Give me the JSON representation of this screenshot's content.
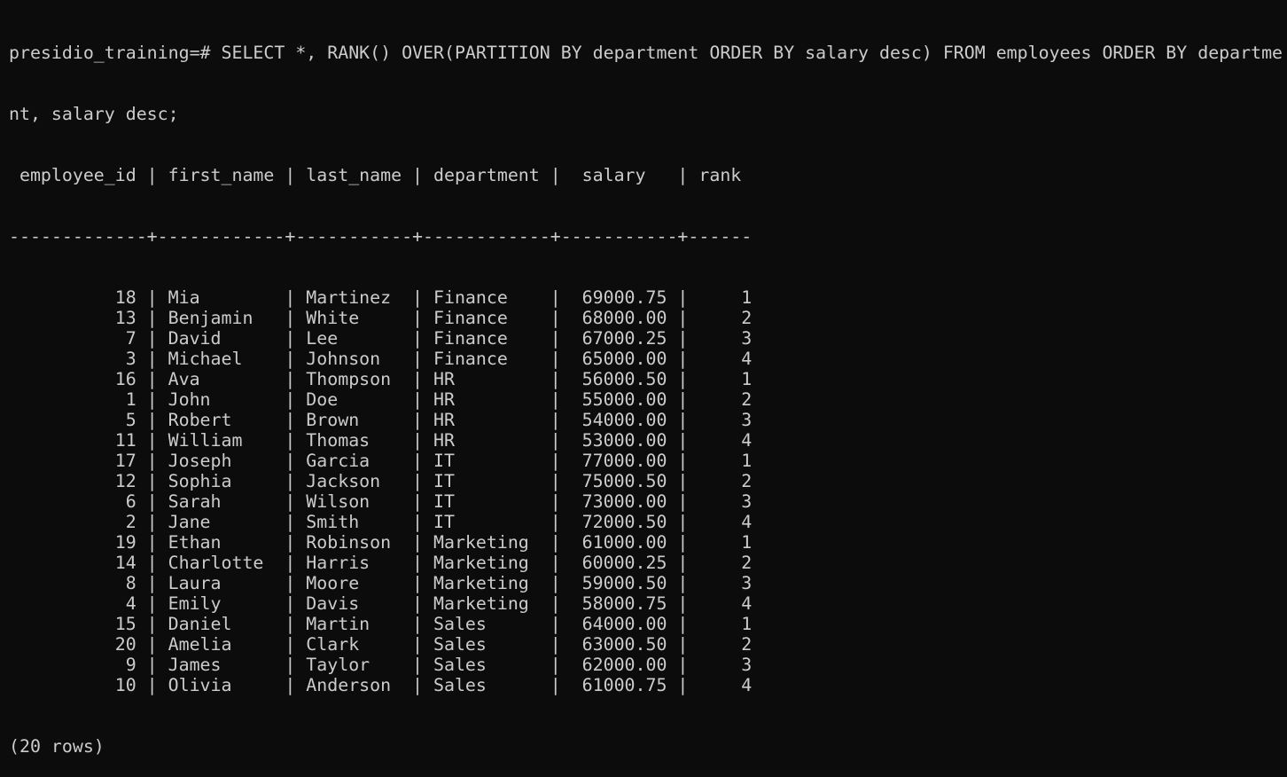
{
  "terminal": {
    "command_lines": [
      "presidio_training=# SELECT *, RANK() OVER(PARTITION BY department ORDER BY salary desc) FROM employees ORDER BY departme",
      "nt, salary desc;"
    ],
    "header_line": " employee_id | first_name | last_name | department |  salary   | rank",
    "separator_line": "-------------+------------+-----------+------------+-----------+------",
    "columns": [
      "employee_id",
      "first_name",
      "last_name",
      "department",
      "salary",
      "rank"
    ],
    "rows": [
      [
        "18",
        "Mia",
        "Martinez",
        "Finance",
        "69000.75",
        "1"
      ],
      [
        "13",
        "Benjamin",
        "White",
        "Finance",
        "68000.00",
        "2"
      ],
      [
        "7",
        "David",
        "Lee",
        "Finance",
        "67000.25",
        "3"
      ],
      [
        "3",
        "Michael",
        "Johnson",
        "Finance",
        "65000.00",
        "4"
      ],
      [
        "16",
        "Ava",
        "Thompson",
        "HR",
        "56000.50",
        "1"
      ],
      [
        "1",
        "John",
        "Doe",
        "HR",
        "55000.00",
        "2"
      ],
      [
        "5",
        "Robert",
        "Brown",
        "HR",
        "54000.00",
        "3"
      ],
      [
        "11",
        "William",
        "Thomas",
        "HR",
        "53000.00",
        "4"
      ],
      [
        "17",
        "Joseph",
        "Garcia",
        "IT",
        "77000.00",
        "1"
      ],
      [
        "12",
        "Sophia",
        "Jackson",
        "IT",
        "75000.50",
        "2"
      ],
      [
        "6",
        "Sarah",
        "Wilson",
        "IT",
        "73000.00",
        "3"
      ],
      [
        "2",
        "Jane",
        "Smith",
        "IT",
        "72000.50",
        "4"
      ],
      [
        "19",
        "Ethan",
        "Robinson",
        "Marketing",
        "61000.00",
        "1"
      ],
      [
        "14",
        "Charlotte",
        "Harris",
        "Marketing",
        "60000.25",
        "2"
      ],
      [
        "8",
        "Laura",
        "Moore",
        "Marketing",
        "59000.50",
        "3"
      ],
      [
        "4",
        "Emily",
        "Davis",
        "Marketing",
        "58000.75",
        "4"
      ],
      [
        "15",
        "Daniel",
        "Martin",
        "Sales",
        "64000.00",
        "1"
      ],
      [
        "20",
        "Amelia",
        "Clark",
        "Sales",
        "63000.50",
        "2"
      ],
      [
        "9",
        "James",
        "Taylor",
        "Sales",
        "62000.00",
        "3"
      ],
      [
        "10",
        "Olivia",
        "Anderson",
        "Sales",
        "61000.75",
        "4"
      ]
    ],
    "footer": "(20 rows)",
    "colors": {
      "background": "#0c0c0c",
      "foreground": "#cccccc"
    }
  }
}
